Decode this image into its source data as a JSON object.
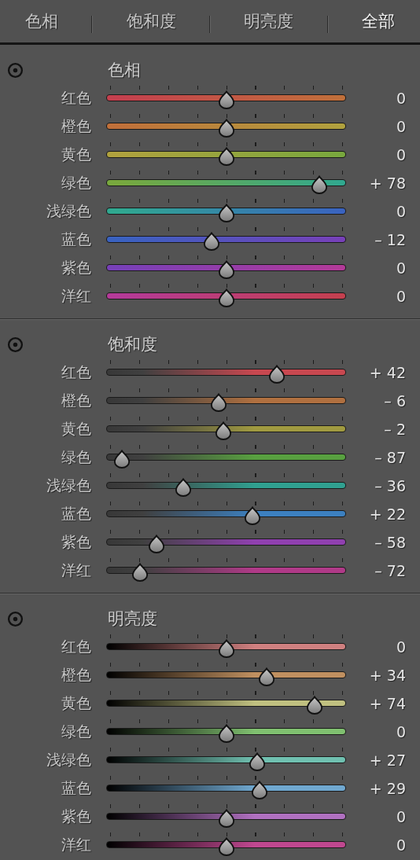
{
  "tabs": [
    {
      "label": "色相",
      "selected": false
    },
    {
      "label": "饱和度",
      "selected": false
    },
    {
      "label": "明亮度",
      "selected": false
    },
    {
      "label": "全部",
      "selected": true
    }
  ],
  "sections": [
    {
      "kind": "hue",
      "title": "色相",
      "rows": [
        {
          "label": "红色",
          "color": "#c4404e",
          "level": 0.5,
          "value": "0"
        },
        {
          "label": "橙色",
          "color": "#c0703a",
          "level": 0.5,
          "value": "0"
        },
        {
          "label": "黄色",
          "color": "#b0a23e",
          "level": 0.5,
          "value": "0"
        },
        {
          "label": "绿色",
          "color": "#78a83e",
          "level": 0.89,
          "value": "+ 78"
        },
        {
          "label": "浅绿色",
          "color": "#30a890",
          "level": 0.5,
          "value": "0"
        },
        {
          "label": "蓝色",
          "color": "#3a62c0",
          "level": 0.44,
          "value": "– 12"
        },
        {
          "label": "紫色",
          "color": "#7840b8",
          "level": 0.5,
          "value": "0"
        },
        {
          "label": "洋红",
          "color": "#b43a98",
          "level": 0.5,
          "value": "0"
        }
      ]
    },
    {
      "kind": "saturation",
      "title": "饱和度",
      "rows": [
        {
          "label": "红色",
          "color": "#c84850",
          "level": 0.71,
          "value": "+ 42"
        },
        {
          "label": "橙色",
          "color": "#b07040",
          "level": 0.47,
          "value": "– 6"
        },
        {
          "label": "黄色",
          "color": "#a09a40",
          "level": 0.49,
          "value": "– 2"
        },
        {
          "label": "绿色",
          "color": "#58a040",
          "level": 0.065,
          "value": "– 87"
        },
        {
          "label": "浅绿色",
          "color": "#30a090",
          "level": 0.32,
          "value": "– 36"
        },
        {
          "label": "蓝色",
          "color": "#3c80c0",
          "level": 0.61,
          "value": "+ 22"
        },
        {
          "label": "紫色",
          "color": "#9040b0",
          "level": 0.21,
          "value": "– 58"
        },
        {
          "label": "洋红",
          "color": "#b03a88",
          "level": 0.14,
          "value": "– 72"
        }
      ]
    },
    {
      "kind": "luminance",
      "title": "明亮度",
      "rows": [
        {
          "label": "红色",
          "color": "#d08080",
          "level": 0.5,
          "value": "0"
        },
        {
          "label": "橙色",
          "color": "#c09060",
          "level": 0.67,
          "value": "+ 34"
        },
        {
          "label": "黄色",
          "color": "#c0c080",
          "level": 0.87,
          "value": "+ 74"
        },
        {
          "label": "绿色",
          "color": "#80c070",
          "level": 0.5,
          "value": "0"
        },
        {
          "label": "浅绿色",
          "color": "#70c0b0",
          "level": 0.63,
          "value": "+ 27"
        },
        {
          "label": "蓝色",
          "color": "#70a8d0",
          "level": 0.64,
          "value": "+ 29"
        },
        {
          "label": "紫色",
          "color": "#b070c0",
          "level": 0.5,
          "value": "0"
        },
        {
          "label": "洋红",
          "color": "#c04890",
          "level": 0.5,
          "value": "0"
        }
      ]
    }
  ]
}
